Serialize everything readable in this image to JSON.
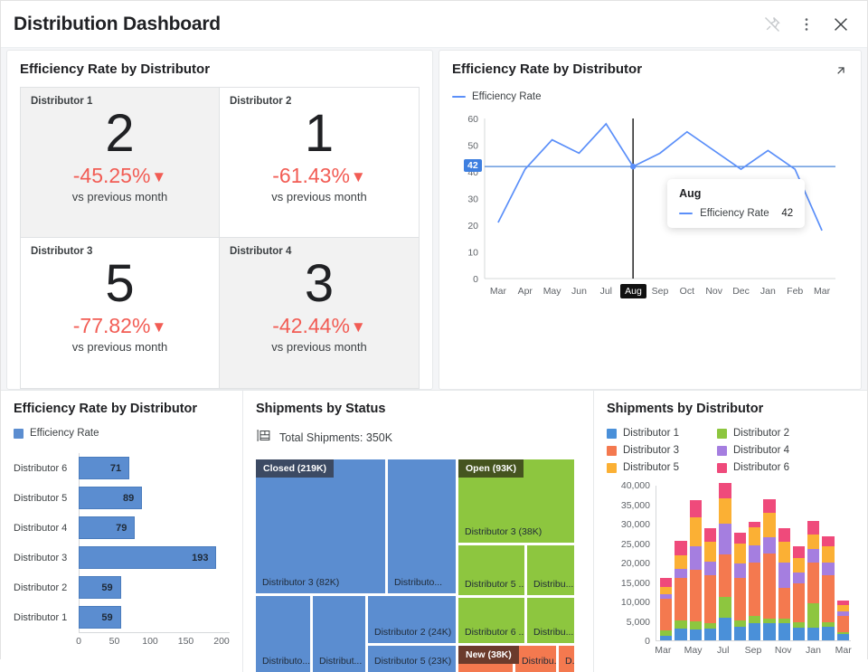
{
  "header": {
    "title": "Distribution Dashboard",
    "icons": [
      {
        "name": "unpin-icon",
        "glyph": "pin-off"
      },
      {
        "name": "more-options-icon",
        "glyph": "kebab"
      },
      {
        "name": "close-icon",
        "glyph": "x"
      }
    ]
  },
  "kpi_panel": {
    "title": "Efficiency Rate by Distributor",
    "cards": [
      {
        "name": "Distributor 1",
        "value": "2",
        "delta": "-45.25%",
        "arrow": "▼",
        "sub": "vs previous month",
        "shaded": true
      },
      {
        "name": "Distributor 2",
        "value": "1",
        "delta": "-61.43%",
        "arrow": "▼",
        "sub": "vs previous month",
        "shaded": false
      },
      {
        "name": "Distributor 3",
        "value": "5",
        "delta": "-77.82%",
        "arrow": "▼",
        "sub": "vs previous month",
        "shaded": false
      },
      {
        "name": "Distributor 4",
        "value": "3",
        "delta": "-42.44%",
        "arrow": "▼",
        "sub": "vs previous month",
        "shaded": true
      }
    ]
  },
  "line_panel": {
    "title": "Efficiency Rate by Distributor",
    "expand_icon": "expand-arrow-icon",
    "legend": "Efficiency Rate",
    "axis_badge": "42",
    "highlight_x": "Aug",
    "tooltip": {
      "title": "Aug",
      "series_name": "Efficiency Rate",
      "value": "42"
    },
    "chart_data": {
      "type": "line",
      "title": "Efficiency Rate by Distributor",
      "xlabel": "",
      "ylabel": "",
      "categories": [
        "Mar",
        "Apr",
        "May",
        "Jun",
        "Jul",
        "Aug",
        "Sep",
        "Oct",
        "Nov",
        "Dec",
        "Jan",
        "Feb",
        "Mar"
      ],
      "ytick_labels": [
        "60",
        "50",
        "40",
        "30",
        "20",
        "10",
        "0"
      ],
      "ylim": [
        0,
        60
      ],
      "grid": false,
      "legend_position": "top-left",
      "series": [
        {
          "name": "Efficiency Rate",
          "color": "#5b8ff9",
          "values": [
            21,
            41,
            52,
            47,
            58,
            42,
            47,
            55,
            48,
            41,
            48,
            41,
            18
          ]
        }
      ],
      "reference_line": 42,
      "marker_index": 5
    }
  },
  "bar_panel": {
    "title": "Efficiency Rate by Distributor",
    "legend": "Efficiency Rate",
    "chart_data": {
      "type": "bar",
      "orientation": "horizontal",
      "title": "Efficiency Rate by Distributor",
      "categories": [
        "Distributor 6",
        "Distributor 5",
        "Distributor 4",
        "Distributor 3",
        "Distributor 2",
        "Distributor 1"
      ],
      "values": [
        71,
        89,
        79,
        193,
        59,
        59
      ],
      "xtick_labels": [
        "0",
        "50",
        "100",
        "150",
        "200"
      ],
      "xlim": [
        0,
        200
      ],
      "ylabel": "",
      "xlabel": "",
      "color": "#5b8dd0",
      "grid": false
    }
  },
  "tree_panel": {
    "title": "Shipments by Status",
    "total_icon": "treemap-measure-icon",
    "total_label": "Total Shipments: 350K",
    "chart_data": {
      "type": "treemap",
      "title": "Shipments by Status",
      "total": "350K",
      "groups": [
        {
          "name": "Closed",
          "label": "Closed (219K)",
          "value": 219,
          "color": "#5b8dd0",
          "cells": [
            {
              "label": "Distributor 3 (82K)",
              "value": 82
            },
            {
              "label": "Distributo...",
              "value": 45
            },
            {
              "label": "Distributor 2 (24K)",
              "value": 24
            },
            {
              "label": "Distributor 5 (23K)",
              "value": 23
            },
            {
              "label": "Distributo...",
              "value": 23
            },
            {
              "label": "Distribut...",
              "value": 22
            }
          ]
        },
        {
          "name": "Open",
          "label": "Open (93K)",
          "value": 93,
          "color": "#8dc63f",
          "cells": [
            {
              "label": "Distributor 3 (38K)",
              "value": 38
            },
            {
              "label": "Distributor 5 ...",
              "value": 17
            },
            {
              "label": "Distribu...",
              "value": 12
            },
            {
              "label": "Distributor 6 ...",
              "value": 15
            },
            {
              "label": "Distribu...",
              "value": 11
            }
          ]
        },
        {
          "name": "New",
          "label": "New (38K)",
          "value": 38,
          "color": "#f4794f",
          "cells": [
            {
              "label": "Distribu...",
              "value": 15
            },
            {
              "label": "Distribu...",
              "value": 14
            },
            {
              "label": "D...",
              "value": 9
            }
          ]
        }
      ]
    }
  },
  "stack_panel": {
    "title": "Shipments by Distributor",
    "legend": [
      {
        "label": "Distributor 1",
        "color": "#4a90d9"
      },
      {
        "label": "Distributor 2",
        "color": "#8dc63f"
      },
      {
        "label": "Distributor 3",
        "color": "#f4794f"
      },
      {
        "label": "Distributor 4",
        "color": "#a57ee0"
      },
      {
        "label": "Distributor 5",
        "color": "#fbb034"
      },
      {
        "label": "Distributor 6",
        "color": "#ef4a7b"
      }
    ],
    "chart_data": {
      "type": "bar",
      "stacked": true,
      "title": "Shipments by Distributor",
      "categories": [
        "Mar",
        "Apr",
        "May",
        "Jun",
        "Jul",
        "Aug",
        "Sep",
        "Oct",
        "Nov",
        "Dec",
        "Jan",
        "Feb",
        "Mar"
      ],
      "xtick_labels": [
        "Mar",
        "May",
        "Jul",
        "Sep",
        "Nov",
        "Jan",
        "Mar"
      ],
      "ytick_labels": [
        "0",
        "5,000",
        "10,000",
        "15,000",
        "20,000",
        "25,000",
        "30,000",
        "35,000",
        "40,000"
      ],
      "ylim": [
        0,
        40000
      ],
      "xlabel": "",
      "ylabel": "",
      "grid": false,
      "legend_position": "top",
      "series": [
        {
          "name": "Distributor 1",
          "color": "#4a90d9",
          "values": [
            1100,
            3100,
            2800,
            3000,
            5900,
            3400,
            4500,
            4400,
            4500,
            3300,
            3300,
            3400,
            1700
          ]
        },
        {
          "name": "Distributor 2",
          "color": "#8dc63f",
          "values": [
            1400,
            2000,
            2200,
            1400,
            5300,
            1800,
            1900,
            1200,
            1100,
            1400,
            6200,
            1200,
            300
          ]
        },
        {
          "name": "Distributor 3",
          "color": "#f4794f",
          "values": [
            8100,
            10900,
            13100,
            12300,
            10800,
            10900,
            13600,
            16700,
            8000,
            9900,
            10400,
            12200,
            4400
          ]
        },
        {
          "name": "Distributor 4",
          "color": "#a57ee0",
          "values": [
            1300,
            2300,
            6200,
            3500,
            8100,
            3600,
            4400,
            4300,
            6500,
            2800,
            3500,
            3200,
            1100
          ]
        },
        {
          "name": "Distributor 5",
          "color": "#fbb034",
          "values": [
            1800,
            3600,
            7400,
            5100,
            6400,
            5200,
            4800,
            6300,
            5200,
            3800,
            3700,
            4200,
            1600
          ]
        },
        {
          "name": "Distributor 6",
          "color": "#ef4a7b",
          "values": [
            2300,
            3700,
            4300,
            3500,
            3900,
            2900,
            1300,
            3500,
            3600,
            2900,
            3500,
            2500,
            1100
          ]
        }
      ]
    }
  }
}
